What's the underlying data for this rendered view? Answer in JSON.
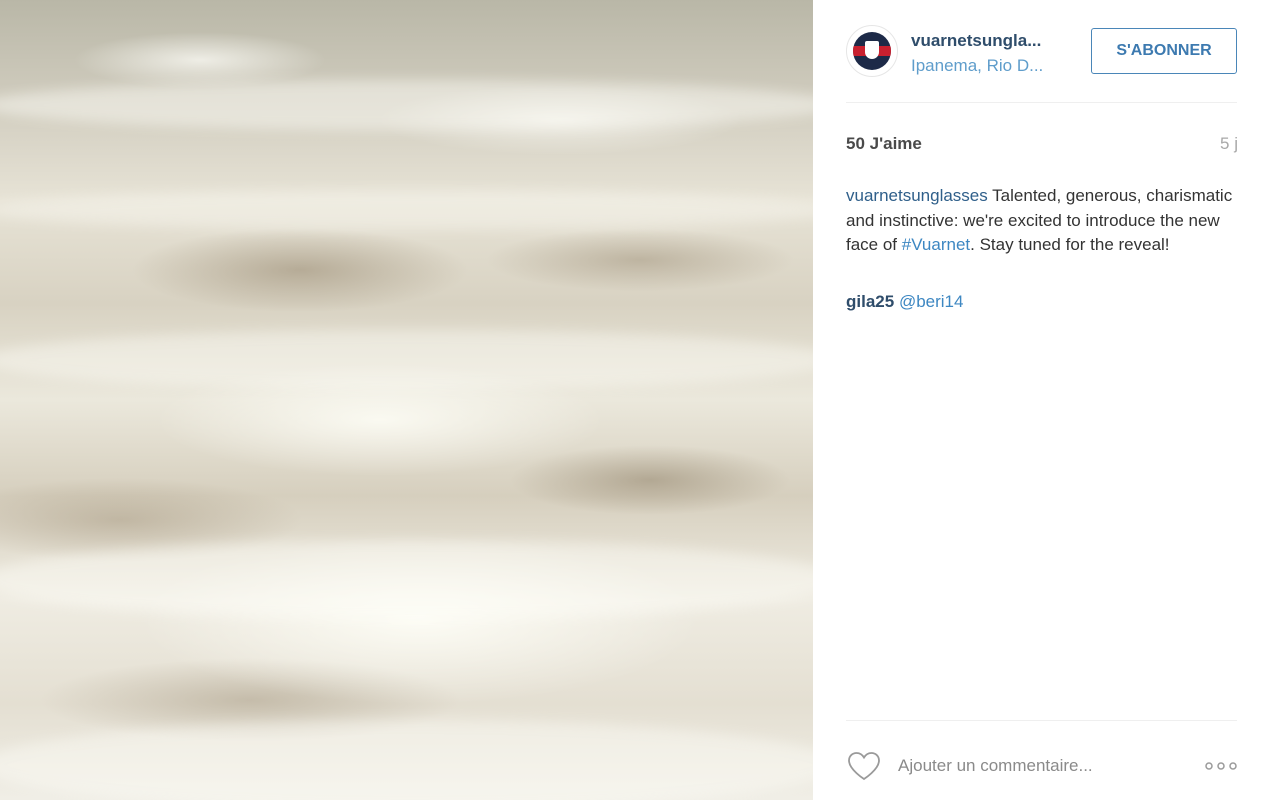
{
  "post": {
    "username": "vuarnetsungla...",
    "location": "Ipanema, Rio D...",
    "follow_label": "S'ABONNER",
    "likes": "50 J'aime",
    "age": "5 j",
    "caption_user": "vuarnetsunglasses",
    "caption_text_1": " Talented, generous, charismatic and instinctive: we're excited to introduce the new face of ",
    "caption_hashtag": "#Vuarnet",
    "caption_text_2": ". Stay tuned for the reveal!",
    "comment_user": "gila25",
    "comment_mention": "@beri14",
    "comment_placeholder": "Ajouter un commentaire...",
    "icons": {
      "avatar": "vuarnet-logo-avatar",
      "like": "heart-icon",
      "more": "more-options-icon"
    }
  },
  "colors": {
    "accent": "#3d7ab0",
    "username": "#2f4d6b",
    "hashtag": "#3d87c2"
  }
}
